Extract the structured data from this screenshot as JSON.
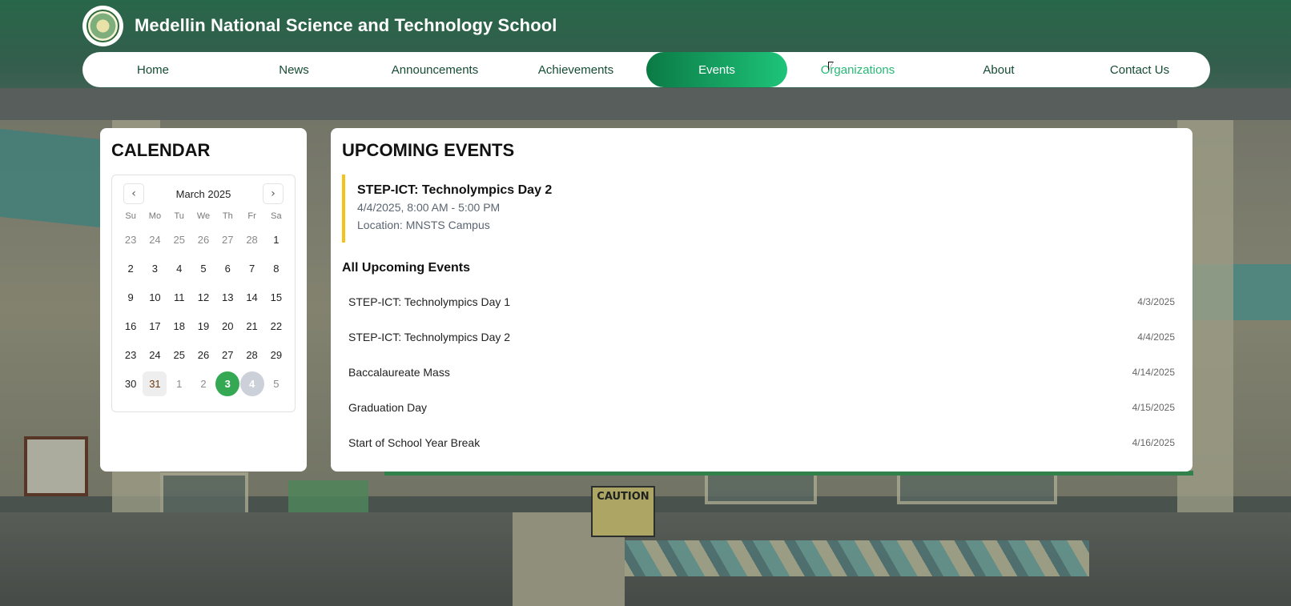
{
  "site": {
    "title": "Medellin National Science and Technology School"
  },
  "nav": {
    "items": [
      {
        "label": "Home"
      },
      {
        "label": "News"
      },
      {
        "label": "Announcements"
      },
      {
        "label": "Achievements"
      },
      {
        "label": "Events",
        "active": true
      },
      {
        "label": "Organizations",
        "hover": true
      },
      {
        "label": "About"
      },
      {
        "label": "Contact Us"
      }
    ]
  },
  "calendar": {
    "heading": "CALENDAR",
    "month_label": "March 2025",
    "prev_icon": "chevron-left-icon",
    "next_icon": "chevron-right-icon",
    "weekdays": [
      "Su",
      "Mo",
      "Tu",
      "We",
      "Th",
      "Fr",
      "Sa"
    ],
    "weeks": [
      [
        {
          "d": "23",
          "m": true
        },
        {
          "d": "24",
          "m": true
        },
        {
          "d": "25",
          "m": true
        },
        {
          "d": "26",
          "m": true
        },
        {
          "d": "27",
          "m": true
        },
        {
          "d": "28",
          "m": true
        },
        {
          "d": "1"
        }
      ],
      [
        {
          "d": "2"
        },
        {
          "d": "3"
        },
        {
          "d": "4"
        },
        {
          "d": "5"
        },
        {
          "d": "6"
        },
        {
          "d": "7"
        },
        {
          "d": "8"
        }
      ],
      [
        {
          "d": "9"
        },
        {
          "d": "10"
        },
        {
          "d": "11"
        },
        {
          "d": "12"
        },
        {
          "d": "13"
        },
        {
          "d": "14"
        },
        {
          "d": "15"
        }
      ],
      [
        {
          "d": "16"
        },
        {
          "d": "17"
        },
        {
          "d": "18"
        },
        {
          "d": "19"
        },
        {
          "d": "20"
        },
        {
          "d": "21"
        },
        {
          "d": "22"
        }
      ],
      [
        {
          "d": "23"
        },
        {
          "d": "24"
        },
        {
          "d": "25"
        },
        {
          "d": "26"
        },
        {
          "d": "27"
        },
        {
          "d": "28"
        },
        {
          "d": "29"
        }
      ],
      [
        {
          "d": "30"
        },
        {
          "d": "31",
          "today": true
        },
        {
          "d": "1",
          "m": true
        },
        {
          "d": "2",
          "m": true
        },
        {
          "d": "3",
          "selected": true
        },
        {
          "d": "4",
          "range": true
        },
        {
          "d": "5",
          "m": true
        }
      ]
    ]
  },
  "events": {
    "heading": "UPCOMING EVENTS",
    "featured": {
      "title": "STEP-ICT: Technolympics Day 2",
      "datetime": "4/4/2025, 8:00 AM - 5:00 PM",
      "location": "Location: MNSTS Campus"
    },
    "all_heading": "All Upcoming Events",
    "list": [
      {
        "name": "STEP-ICT: Technolympics Day 1",
        "date": "4/3/2025"
      },
      {
        "name": "STEP-ICT: Technolympics Day 2",
        "date": "4/4/2025"
      },
      {
        "name": "Baccalaureate Mass",
        "date": "4/14/2025"
      },
      {
        "name": "Graduation Day",
        "date": "4/15/2025"
      },
      {
        "name": "Start of School Year Break",
        "date": "4/16/2025"
      }
    ]
  },
  "background_sign": "CAUTION",
  "colors": {
    "accent_start": "#0b7a45",
    "accent_end": "#1ec47a",
    "featured_border": "#f4c21a",
    "selected_day": "#34a853"
  }
}
